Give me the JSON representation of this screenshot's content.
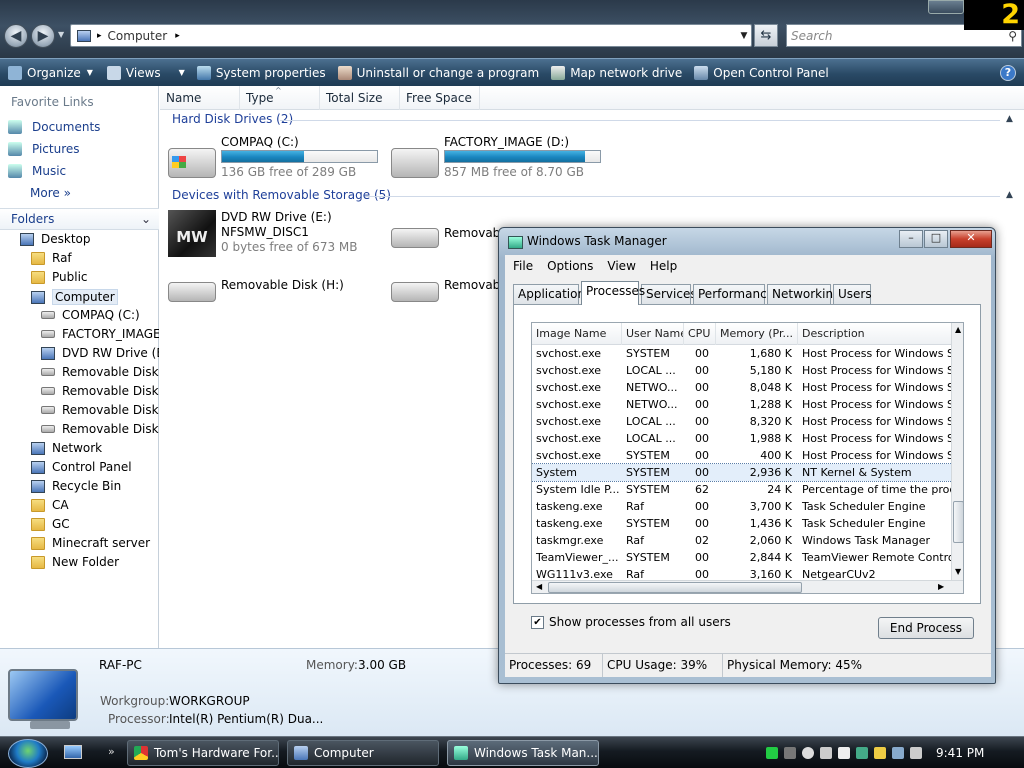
{
  "badge": "2",
  "address": {
    "path": "Computer",
    "search_placeholder": "Search"
  },
  "toolbar": [
    {
      "label": "Organize",
      "icon": "organize-icon",
      "dropdown": true
    },
    {
      "label": "Views",
      "icon": "views-icon",
      "dropdown": true
    },
    {
      "label": "System properties",
      "icon": "system-properties-icon"
    },
    {
      "label": "Uninstall or change a program",
      "icon": "uninstall-icon"
    },
    {
      "label": "Map network drive",
      "icon": "network-drive-icon"
    },
    {
      "label": "Open Control Panel",
      "icon": "control-panel-icon"
    }
  ],
  "sidebar": {
    "favorite_links_header": "Favorite Links",
    "favorite_links": [
      "Documents",
      "Pictures",
      "Music"
    ],
    "more": "More »",
    "folders_header": "Folders",
    "tree": [
      {
        "label": "Desktop",
        "icon": "monitor-icon",
        "level": 0
      },
      {
        "label": "Raf",
        "icon": "folder-icon",
        "level": 1
      },
      {
        "label": "Public",
        "icon": "folder-icon",
        "level": 1
      },
      {
        "label": "Computer",
        "icon": "computer-icon",
        "level": 1,
        "selected": true
      },
      {
        "label": "COMPAQ (C:)",
        "icon": "drive-icon",
        "level": 2
      },
      {
        "label": "FACTORY_IMAGE",
        "icon": "drive-icon",
        "level": 2
      },
      {
        "label": "DVD RW Drive (E:)",
        "icon": "dvd-icon",
        "level": 2
      },
      {
        "label": "Removable Disk (F",
        "icon": "removable-drive-icon",
        "level": 2
      },
      {
        "label": "Removable Disk (G",
        "icon": "removable-drive-icon",
        "level": 2
      },
      {
        "label": "Removable Disk (H",
        "icon": "removable-drive-icon",
        "level": 2
      },
      {
        "label": "Removable Disk (I",
        "icon": "removable-drive-icon",
        "level": 2
      },
      {
        "label": "Network",
        "icon": "network-icon",
        "level": 1
      },
      {
        "label": "Control Panel",
        "icon": "control-panel-icon",
        "level": 1
      },
      {
        "label": "Recycle Bin",
        "icon": "recycle-bin-icon",
        "level": 1
      },
      {
        "label": "CA",
        "icon": "folder-icon",
        "level": 1
      },
      {
        "label": "GC",
        "icon": "folder-icon",
        "level": 1
      },
      {
        "label": "Minecraft server",
        "icon": "folder-icon",
        "level": 1
      },
      {
        "label": "New Folder",
        "icon": "folder-icon",
        "level": 1
      }
    ]
  },
  "columns": [
    "Name",
    "Type",
    "Total Size",
    "Free Space"
  ],
  "groups": {
    "hard_disks": "Hard Disk Drives (2)",
    "removable": "Devices with Removable Storage (5)"
  },
  "hard_drives": [
    {
      "name": "COMPAQ (C:)",
      "free": "136 GB free of 289 GB",
      "used_fraction": 0.53
    },
    {
      "name": "FACTORY_IMAGE (D:)",
      "free": "857 MB free of 8.70 GB",
      "used_fraction": 0.9
    }
  ],
  "removable_items": [
    {
      "name": "DVD RW Drive (E:)",
      "label": "NFSMW_DISC1",
      "free": "0 bytes free of 673 MB",
      "icon": "nfs-mw-disc-icon",
      "disc_text": "MW"
    },
    {
      "name": "Removable",
      "icon": "removable-drive-icon"
    },
    {
      "name": "Removable Disk (H:)",
      "icon": "removable-drive-icon"
    },
    {
      "name": "Removable",
      "icon": "removable-drive-icon"
    }
  ],
  "details": {
    "pc_name": "RAF-PC",
    "memory_label": "Memory:",
    "memory_value": "3.00 GB",
    "workgroup_label": "Workgroup:",
    "workgroup_value": "WORKGROUP",
    "processor_label": "Processor:",
    "processor_value": "Intel(R) Pentium(R) Dua..."
  },
  "taskbar": {
    "items": [
      {
        "label": "Tom's Hardware For...",
        "icon": "chrome-icon"
      },
      {
        "label": "Computer",
        "icon": "computer-icon"
      },
      {
        "label": "Windows Task Man...",
        "icon": "task-manager-icon",
        "active": true
      }
    ],
    "clock": "9:41 PM"
  },
  "task_manager": {
    "title": "Windows Task Manager",
    "menu": [
      "File",
      "Options",
      "View",
      "Help"
    ],
    "tabs": [
      "Applications",
      "Processes",
      "Services",
      "Performance",
      "Networking",
      "Users"
    ],
    "active_tab": "Processes",
    "columns": [
      "Image Name",
      "User Name",
      "CPU",
      "Memory (Pr...",
      "Description"
    ],
    "processes": [
      [
        "svchost.exe",
        "SYSTEM",
        "00",
        "1,680 K",
        "Host Process for Windows Ser"
      ],
      [
        "svchost.exe",
        "LOCAL ...",
        "00",
        "5,180 K",
        "Host Process for Windows Ser"
      ],
      [
        "svchost.exe",
        "NETWO...",
        "00",
        "8,048 K",
        "Host Process for Windows Ser"
      ],
      [
        "svchost.exe",
        "NETWO...",
        "00",
        "1,288 K",
        "Host Process for Windows Ser"
      ],
      [
        "svchost.exe",
        "LOCAL ...",
        "00",
        "8,320 K",
        "Host Process for Windows Ser"
      ],
      [
        "svchost.exe",
        "LOCAL ...",
        "00",
        "1,988 K",
        "Host Process for Windows Ser"
      ],
      [
        "svchost.exe",
        "SYSTEM",
        "00",
        "400 K",
        "Host Process for Windows Ser"
      ],
      [
        "System",
        "SYSTEM",
        "00",
        "2,936 K",
        "NT Kernel & System"
      ],
      [
        "System Idle P...",
        "SYSTEM",
        "62",
        "24 K",
        "Percentage of time the proces"
      ],
      [
        "taskeng.exe",
        "Raf",
        "00",
        "3,700 K",
        "Task Scheduler Engine"
      ],
      [
        "taskeng.exe",
        "SYSTEM",
        "00",
        "1,436 K",
        "Task Scheduler Engine"
      ],
      [
        "taskmgr.exe",
        "Raf",
        "02",
        "2,060 K",
        "Windows Task Manager"
      ],
      [
        "TeamViewer_...",
        "SYSTEM",
        "00",
        "2,844 K",
        "TeamViewer Remote Control A"
      ],
      [
        "WG111v3.exe",
        "Raf",
        "00",
        "3,160 K",
        "NetgearCUv2"
      ]
    ],
    "selected_process": "System",
    "show_all_label": "Show processes from all users",
    "show_all_checked": true,
    "end_process": "End Process",
    "status": {
      "processes": "Processes: 69",
      "cpu": "CPU Usage: 39%",
      "memory": "Physical Memory: 45%"
    }
  }
}
